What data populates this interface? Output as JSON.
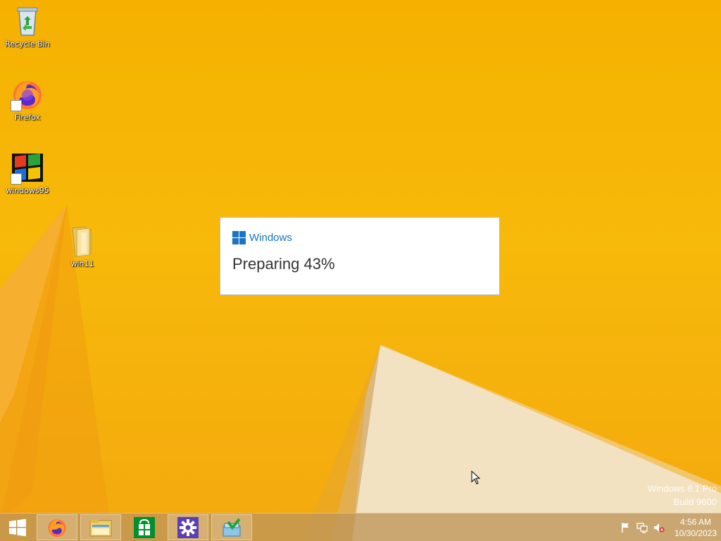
{
  "desktop": {
    "icons": [
      {
        "label": "Recycle Bin",
        "icon": "recycle-bin-icon"
      },
      {
        "label": "Firefox",
        "icon": "firefox-icon"
      },
      {
        "label": "windows95",
        "icon": "windows95-icon"
      },
      {
        "label": "win11",
        "icon": "folder-icon"
      }
    ]
  },
  "dialog": {
    "brand": "Windows",
    "status": "Preparing 43%",
    "progress_percent": 43,
    "brand_color": "#1a73c4"
  },
  "watermark": {
    "line1": "Windows 8.1 Pro",
    "line2": "Build 9600"
  },
  "taskbar": {
    "start_icon": "windows-start-icon",
    "pinned": [
      {
        "icon": "firefox-icon"
      },
      {
        "icon": "file-explorer-icon"
      },
      {
        "icon": "store-icon"
      },
      {
        "icon": "settings-icon"
      },
      {
        "icon": "installer-icon"
      }
    ],
    "tray": {
      "icons": [
        "action-center-flag-icon",
        "network-icon",
        "volume-muted-icon"
      ],
      "time": "4:56 AM",
      "date": "10/30/2023"
    }
  },
  "colors": {
    "wallpaper": "#f6b100",
    "taskbar": "#be965a"
  }
}
